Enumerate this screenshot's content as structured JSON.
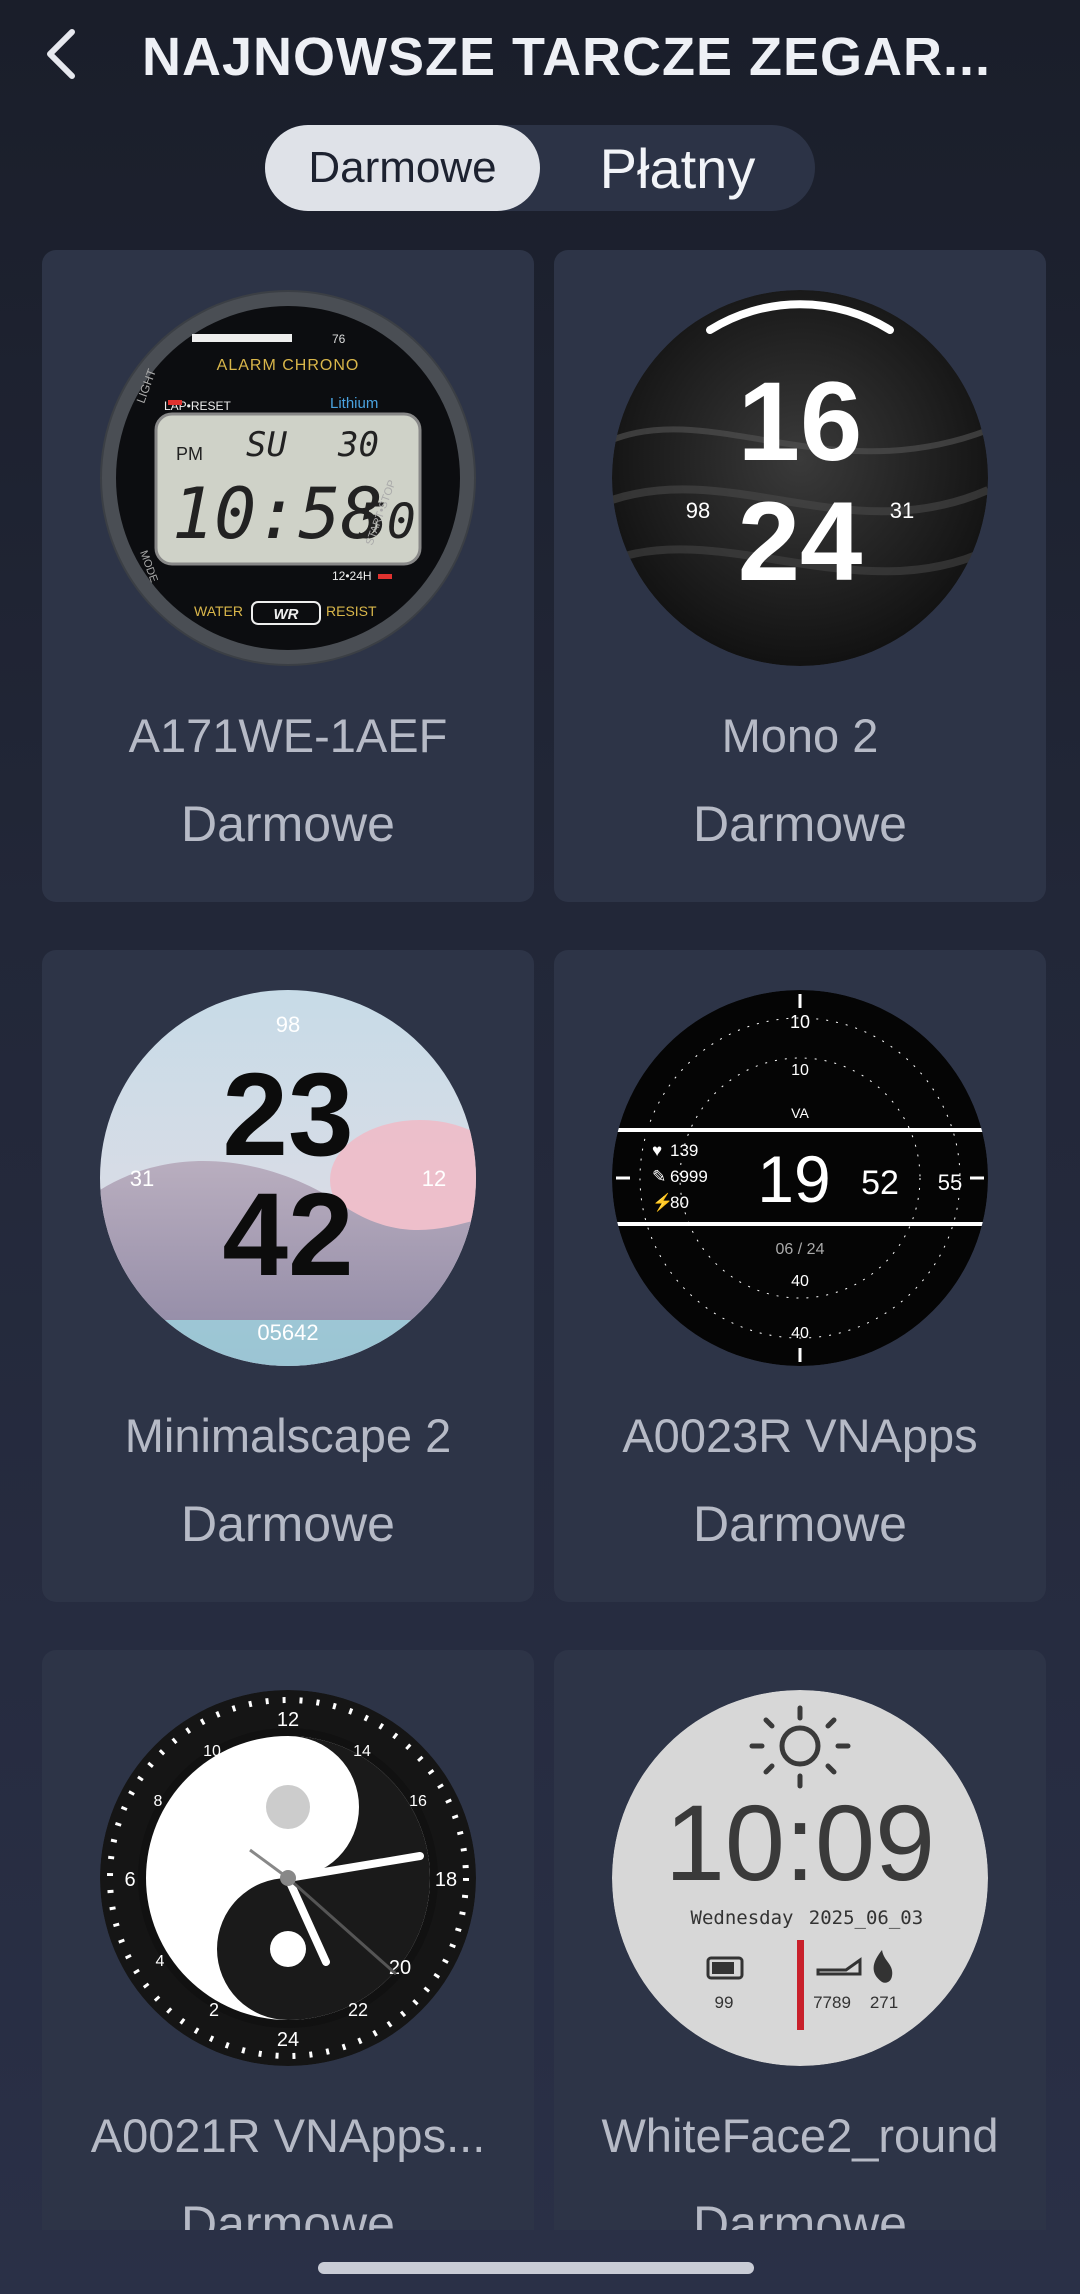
{
  "header": {
    "title": "NAJNOWSZE TARCZE ZEGAR...",
    "back_icon": "chevron-left-icon"
  },
  "tabs": {
    "free_label": "Darmowe",
    "paid_label": "Płatny",
    "selected": "Darmowe"
  },
  "faces": [
    {
      "name": "A171WE-1AEF",
      "price": "Darmowe",
      "face": {
        "top_text": "ALARM CHRONO",
        "mode": "LAP•RESET",
        "brand": "Lithium",
        "day": "SU",
        "date": "30",
        "pm": "PM",
        "time": "10:58",
        "sec": "50",
        "h24": "12•24H",
        "water": "WATER",
        "wr": "WR",
        "resist": "RESIST",
        "light": "LIGHT",
        "mode_lbl": "MODE",
        "startstop": "START•STOP",
        "battery": "76"
      }
    },
    {
      "name": "Mono 2",
      "price": "Darmowe",
      "face": {
        "hour": "16",
        "minute": "24",
        "left": "98",
        "right": "31"
      }
    },
    {
      "name": "Minimalscape 2",
      "price": "Darmowe",
      "face": {
        "hour": "23",
        "minute": "42",
        "top": "98",
        "left": "31",
        "right": "12",
        "bottom": "05642"
      }
    },
    {
      "name": "A0023R VNApps",
      "price": "Darmowe",
      "face": {
        "logo": "VA",
        "heart": "139",
        "steps": "6999",
        "battery": "80",
        "hour": "19",
        "minute": "52",
        "sec": "55",
        "date": "06 / 24"
      }
    },
    {
      "name": "A0021R VNApps...",
      "price": "Darmowe",
      "face": {
        "n12": "12",
        "n6": "6",
        "n18": "18",
        "n24": "24",
        "n20": "20",
        "n22": "22",
        "n2": "2",
        "n4": "4",
        "n14": "14",
        "n16": "16",
        "n10": "10",
        "n8": "8"
      }
    },
    {
      "name": "WhiteFace2_round",
      "price": "Darmowe",
      "face": {
        "time": "10:09",
        "day": "Wednesday",
        "date": "2025_06_03",
        "battery": "99",
        "steps": "7789",
        "cal": "271"
      }
    }
  ],
  "colors": {
    "background": "#1f2433",
    "card": "#2d3447",
    "accent_red": "#c8202b"
  }
}
